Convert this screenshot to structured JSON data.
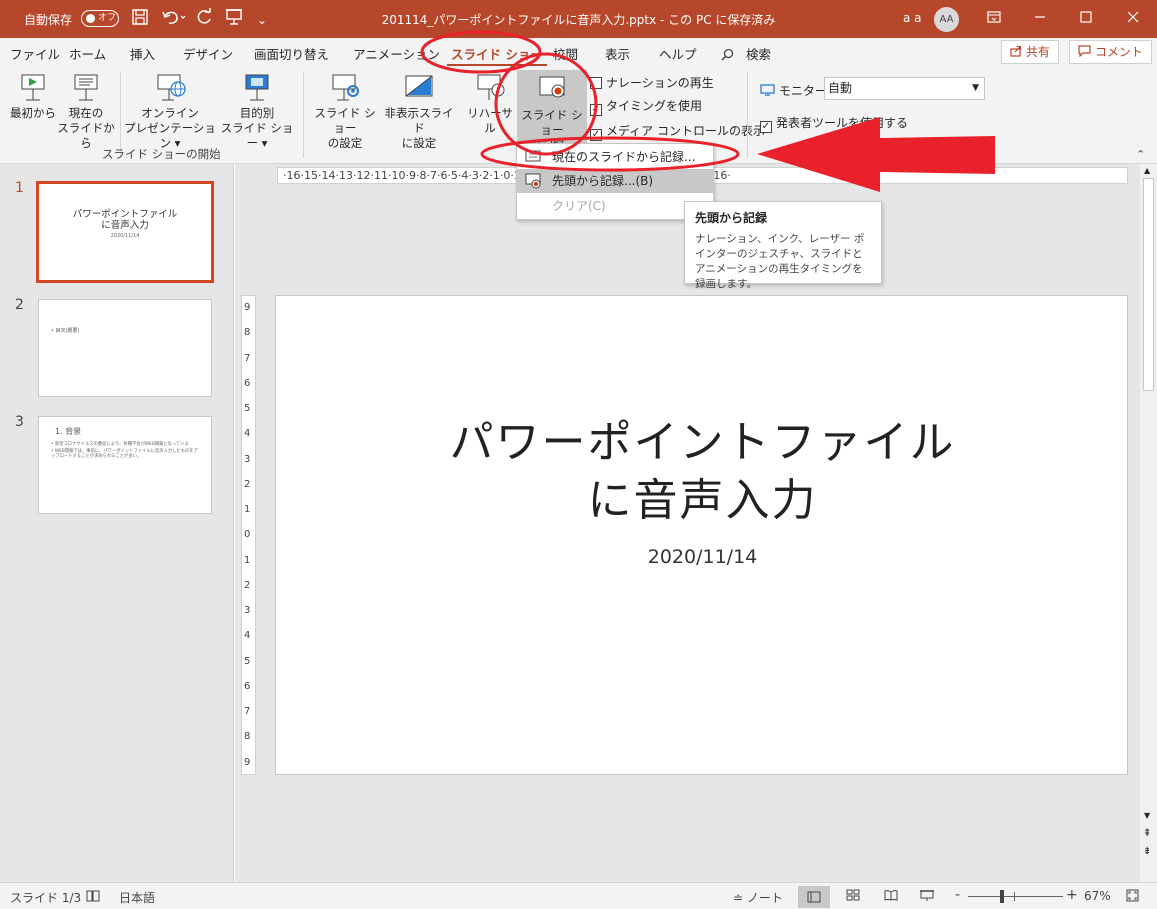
{
  "titlebar": {
    "autosave_label": "自動保存",
    "autosave_toggle": "オフ",
    "save_icon": "save-icon",
    "undo_icon": "undo-icon",
    "redo_icon": "redo-icon",
    "present_icon": "present-icon",
    "more_icon": "customize-qat-icon",
    "title": "201114_パワーポイントファイルに音声入力.pptx - この PC に保存済み",
    "user": "a a",
    "avatar": "AA",
    "ribbon_options_icon": "ribbon-display-options-icon",
    "minimize_icon": "minimize-icon",
    "maximize_icon": "maximize-icon",
    "close_icon": "close-icon",
    "color": "#b7472a"
  },
  "tabs": [
    {
      "label": "ファイル"
    },
    {
      "label": "ホーム"
    },
    {
      "label": "挿入"
    },
    {
      "label": "デザイン"
    },
    {
      "label": "画面切り替え"
    },
    {
      "label": "アニメーション"
    },
    {
      "label": "スライド ショー",
      "active": true
    },
    {
      "label": "校閲"
    },
    {
      "label": "表示"
    },
    {
      "label": "ヘルプ"
    }
  ],
  "search": {
    "icon": "search-icon",
    "label": "検索"
  },
  "share": {
    "icon": "share-icon",
    "label": "共有"
  },
  "comment": {
    "icon": "comment-icon",
    "label": "コメント"
  },
  "ribbon": {
    "from_beginning": "最初から",
    "from_current_1": "現在の",
    "from_current_2": "スライドから",
    "online_1": "オンライン",
    "online_2": "プレゼンテーション",
    "custom_1": "目的別",
    "custom_2": "スライド ショー",
    "group_start": "スライド ショーの開始",
    "setup_1": "スライド ショー",
    "setup_2": "の設定",
    "hide_1": "非表示スライド",
    "hide_2": "に設定",
    "rehearse": "リハーサル",
    "record_1": "スライド ショー",
    "record_2": "の記録",
    "play_narrations": "ナレーションの再生",
    "use_timings": "タイミングを使用",
    "show_media_controls": "メディア コントロールの表示",
    "monitor_label": "モニター:",
    "monitor_value": "自動",
    "presenter_view": "発表者ツールを使用する"
  },
  "record_menu": {
    "from_current": "現在のスライドから記録...(R)",
    "from_beginning": "先頭から記録...(B)",
    "clear": "クリア(C)"
  },
  "tooltip": {
    "title": "先頭から記録",
    "body": "ナレーション、インク、レーザー ポインターのジェスチャ、スライドとアニメーションの再生タイミングを録画します。"
  },
  "ruler": {
    "horizontal": "·16·15·14·13·12·11·10·9·8·7·6·5·4·3·2·1·0·1·2·3·4·5·6·7·8·9·10·11·12·13·14·15·16·",
    "vertical": [
      "9",
      "8",
      "7",
      "6",
      "5",
      "4",
      "3",
      "2",
      "1",
      "0",
      "1",
      "2",
      "3",
      "4",
      "5",
      "6",
      "7",
      "8",
      "9"
    ]
  },
  "thumbnails": [
    {
      "num": "1",
      "title": "パワーポイントファイル\nに音声入力",
      "date": "2020/11/14",
      "selected": true
    },
    {
      "num": "2",
      "bullet": "• 目次(概要)"
    },
    {
      "num": "3",
      "heading": "1. 背景",
      "bullets": [
        "• 新型コロナウイルスの蔓延により、各種学会がWEB開催となっている",
        "• WEB開催では、事前に、パワーポイントファイルに音声入力したものをアップロードすることが求められることが多い。"
      ]
    }
  ],
  "slide": {
    "title_line1": "パワーポイントファイル",
    "title_line2": "に音声入力",
    "subtitle": "2020/11/14"
  },
  "statusbar": {
    "slide_info": "スライド 1/3",
    "accessibility_icon": "accessibility-icon",
    "language": "日本語",
    "notes": "ノート",
    "view_normal_icon": "normal-view-icon",
    "view_sorter_icon": "slide-sorter-icon",
    "view_reading_icon": "reading-view-icon",
    "view_slideshow_icon": "slideshow-view-icon",
    "zoom_minus": "-",
    "zoom_plus": "+",
    "zoom": "67%",
    "fit_icon": "fit-to-window-icon",
    "zoom_level": 0.35
  },
  "annotation_color": "#e8212a"
}
